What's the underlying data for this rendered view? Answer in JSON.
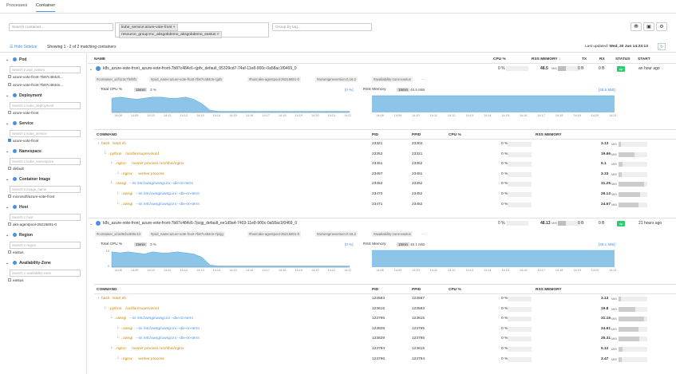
{
  "tabs": [
    {
      "label": "Processes"
    },
    {
      "label": "Container"
    }
  ],
  "filters": {
    "search_placeholder": "Search container...",
    "tag_chips": [
      "kube_service:azure-vote-front ×",
      "resource_group:mc_aksgobdemo_aksgobdemo_eastus ×"
    ],
    "group_placeholder": "Group by tag..."
  },
  "toolbar": {
    "hide_sidebar": "Hide Sidebar",
    "showing": "Showing 1 - 2 of 2 matching containers",
    "last_updated_label": "Last updated:",
    "last_updated_value": "Wed, 20 Jun 14:23:13"
  },
  "sidebar": {
    "groups": [
      {
        "title": "Pod",
        "search": "Search 2 pod_names",
        "items": [
          {
            "label": "azure-vote-front-7b87c484c6..."
          },
          {
            "label": "azure-vote-front-7b87c484c6..."
          }
        ]
      },
      {
        "title": "Deployment",
        "search": "Search 1 kube_deployment",
        "items": [
          {
            "label": "azure-vote-front"
          }
        ]
      },
      {
        "title": "Service",
        "search": "Search 1 kube_service",
        "items": [
          {
            "label": "azure-vote-front",
            "checked": true
          }
        ]
      },
      {
        "title": "Namespace",
        "search": "Search 1 kube_namespace",
        "items": [
          {
            "label": "default"
          }
        ]
      },
      {
        "title": "Container Image",
        "search": "Search 1 image_name",
        "items": [
          {
            "label": "microsoft/azure-vote-front"
          }
        ]
      },
      {
        "title": "Host",
        "search": "Search 1 host",
        "items": [
          {
            "label": "aks-agentpool-25215801-0"
          }
        ]
      },
      {
        "title": "Region",
        "search": "Search 1 region",
        "items": [
          {
            "label": "eastus"
          }
        ]
      },
      {
        "title": "Availability-Zone",
        "search": "Search 1 availability-zone",
        "items": [
          {
            "label": "eastus"
          }
        ]
      }
    ]
  },
  "columns": {
    "name": "NAME",
    "cpu": "CPU %",
    "rss": "RSS MEMORY ↓",
    "tx": "TX",
    "rx": "RX",
    "status": "STATUS",
    "start": "START"
  },
  "proc_columns": {
    "command": "COMMAND",
    "pid": "PID",
    "ppid": "PPID",
    "cpu": "CPU %",
    "rss": "RSS MEMORY"
  },
  "graph_labels": {
    "total_cpu": "Total CPU %",
    "rss": "RSS Memory",
    "window": "15min"
  },
  "containers": [
    {
      "name": "k8s_azure-vote-front_azure-vote-front-7b87c484c6-cjpfx_default_05329cd7-74af-11e8-900c-0a58ac1f0469_0",
      "cpu": "0 %",
      "rss": "48.5",
      "rss_unit": "MiB",
      "tx": "0 B",
      "rx": "0 B",
      "status": "up",
      "start": "an hour ago",
      "tags": [
        "#container_id:f113c7fef8f1",
        "#pod_name:azure-vote-front-7b87c484c6-cjpfx",
        "#host:aks-agentpool-25215801-0",
        "#azsengineversion:0.16.2",
        "#availability-zone:eastus"
      ],
      "cpu_pct": "3 %",
      "cpu_link": "[0 %]",
      "rss_val": "48.5 MiB",
      "rss_link": "[48.5 MiB]",
      "cpu_series": [
        13,
        14,
        13,
        12,
        13,
        14,
        14,
        13,
        13,
        14,
        12,
        8,
        2,
        1,
        1,
        1,
        1,
        1,
        1,
        1,
        1,
        1,
        1,
        1,
        1,
        1,
        1,
        1,
        1,
        1
      ],
      "cpu_yticks": [
        "",
        ""
      ],
      "x_ticks": [
        "14:08",
        "14:09",
        "14:10",
        "14:11",
        "14:12",
        "14:13",
        "14:14",
        "14:15",
        "14:16",
        "14:17",
        "14:18",
        "14:19",
        "14:20",
        "14:21",
        "14:22"
      ],
      "rss_x_ticks": [
        "14:08",
        "14:09",
        "14:10",
        "14:11",
        "14:12",
        "14:13",
        "14:14",
        "14:15",
        "14:16",
        "14:17",
        "14:18",
        "14:19",
        "14:20",
        "14:21"
      ],
      "processes": [
        {
          "indent": 0,
          "cmd_a": "bash",
          "cmd_b": "/start.sh",
          "pid": "23321",
          "ppid": "23304",
          "cpu": "0 %",
          "rss": "3.13",
          "rss_unit": "MiB"
        },
        {
          "indent": 1,
          "cmd_a": "python",
          "cmd_b": "/usr/bin/supervisord",
          "pid": "23352",
          "ppid": "23321",
          "cpu": "0 %",
          "rss": "19.66",
          "rss_unit": "MiB"
        },
        {
          "indent": 2,
          "cmd_a": "nginx:",
          "cmd_b": "master process /usr/sbin/nginx",
          "pid": "23451",
          "ppid": "23352",
          "cpu": "0 %",
          "rss": "5.1",
          "rss_unit": "MiB"
        },
        {
          "indent": 3,
          "cmd_a": "nginx:",
          "cmd_b": "worker process",
          "pid": "23457",
          "ppid": "23451",
          "cpu": "0 %",
          "rss": "3.33",
          "rss_unit": "MiB"
        },
        {
          "indent": 2,
          "cmd_a": "uwsgi",
          "cmd_b": "--ini /etc/uwsgi/uwsgi.ini --die-on-term",
          "pid": "23452",
          "ppid": "23352",
          "cpu": "0 %",
          "rss": "31.25",
          "rss_unit": "MiB"
        },
        {
          "indent": 3,
          "cmd_a": "uwsgi",
          "cmd_b": "--ini /etc/uwsgi/uwsgi.ini --die-on-term",
          "pid": "23470",
          "ppid": "23452",
          "cpu": "0 %",
          "rss": "26.13",
          "rss_unit": "MiB"
        },
        {
          "indent": 3,
          "cmd_a": "uwsgi",
          "cmd_b": "--ini /etc/uwsgi/uwsgi.ini --die-on-term",
          "pid": "23471",
          "ppid": "23452",
          "cpu": "0 %",
          "rss": "24.57",
          "rss_unit": "MiB"
        }
      ]
    },
    {
      "name": "k8s_azure-vote-front_azure-vote-front-7b87c484c6-7pzjg_default_ee1d9a4-7403-11e8-900c-0a58ac1f0469_0",
      "cpu": "0 %",
      "rss": "48.13",
      "rss_unit": "MiB",
      "tx": "0 B",
      "rx": "0 B",
      "status": "up",
      "start": "21 hours ago",
      "tags": [
        "#container_id:a29cbc806c13",
        "#pod_name:azure-vote-front-7b87c484c6-7pzjg",
        "#host:aks-agentpool-25215801-0",
        "#azsengineversion:0.16.2",
        "#availability-zone:eastus"
      ],
      "cpu_pct": "3 %",
      "cpu_link": "[0 %]",
      "rss_val": "48.1 MiB",
      "rss_link": "[48.1 MiB]",
      "cpu_series": [
        14,
        13,
        14,
        13,
        12,
        14,
        13,
        13,
        14,
        13,
        12,
        9,
        2,
        1,
        1,
        1,
        1,
        1,
        1,
        1,
        1,
        1,
        1,
        1,
        1,
        1,
        1,
        1,
        1,
        1
      ],
      "cpu_yticks": [
        "10",
        "0"
      ],
      "x_ticks": [
        "14:08",
        "14:09",
        "14:10",
        "14:11",
        "14:12",
        "14:13",
        "14:14",
        "14:15",
        "14:16",
        "14:17",
        "14:18",
        "14:19",
        "14:20",
        "14:21",
        "14:22"
      ],
      "rss_x_ticks": [
        "14:08",
        "14:09",
        "14:10",
        "14:11",
        "14:12",
        "14:13",
        "14:14",
        "14:15",
        "14:16",
        "14:17",
        "14:18",
        "14:19",
        "14:20",
        "14:21"
      ],
      "processes": [
        {
          "indent": 0,
          "cmd_a": "bash",
          "cmd_b": "/start.sh",
          "pid": "123583",
          "ppid": "123567",
          "cpu": "0 %",
          "rss": "3.13",
          "rss_unit": "MiB"
        },
        {
          "indent": 1,
          "cmd_a": "python",
          "cmd_b": "/usr/bin/supervisord",
          "pid": "123615",
          "ppid": "123583",
          "cpu": "0 %",
          "rss": "19.8",
          "rss_unit": "MiB"
        },
        {
          "indent": 2,
          "cmd_a": "uwsgi",
          "cmd_b": "--ini /etc/uwsgi/uwsgi.ini --die-on-term",
          "pid": "123795",
          "ppid": "123615",
          "cpu": "0 %",
          "rss": "31.15",
          "rss_unit": "MiB"
        },
        {
          "indent": 3,
          "cmd_a": "uwsgi",
          "cmd_b": "--ini /etc/uwsgi/uwsgi.ini --die-on-term",
          "pid": "123828",
          "ppid": "123795",
          "cpu": "0 %",
          "rss": "24.61",
          "rss_unit": "MiB"
        },
        {
          "indent": 3,
          "cmd_a": "uwsgi",
          "cmd_b": "--ini /etc/uwsgi/uwsgi.ini --die-on-term",
          "pid": "123829",
          "ppid": "123795",
          "cpu": "0 %",
          "rss": "25.31",
          "rss_unit": "MiB"
        },
        {
          "indent": 2,
          "cmd_a": "nginx:",
          "cmd_b": "master process /usr/sbin/nginx",
          "pid": "123794",
          "ppid": "123615",
          "cpu": "0 %",
          "rss": "5.12",
          "rss_unit": "MiB"
        },
        {
          "indent": 3,
          "cmd_a": "nginx:",
          "cmd_b": "worker process",
          "pid": "123796",
          "ppid": "123794",
          "cpu": "0 %",
          "rss": "3.47",
          "rss_unit": "MiB"
        }
      ]
    }
  ],
  "colors": {
    "accent": "#4a90e2",
    "chart_fill": "#8cc5e8",
    "status_up": "#2ecc71",
    "cmd_primary": "#c98a00"
  }
}
